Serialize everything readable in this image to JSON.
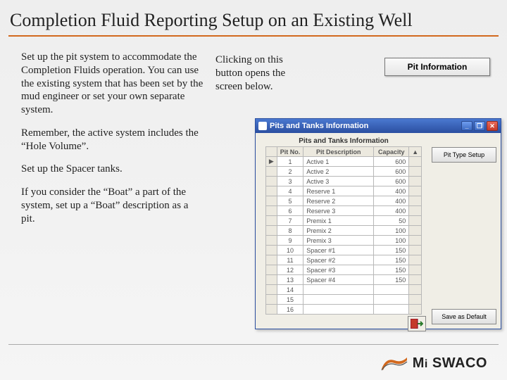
{
  "title": "Completion Fluid Reporting Setup on an Existing Well",
  "left": {
    "p1": "Set up the pit system to accommodate the Completion Fluids operation. You can use the existing system that has been set by the mud engineer or set your own separate system.",
    "p2": "Remember, the active system includes the “Hole Volume”.",
    "p3": "Set up the Spacer tanks.",
    "p4": "If you consider the “Boat” a part of the system, set up a “Boat” description as a pit."
  },
  "mid": {
    "text": "Clicking on this button opens the screen below."
  },
  "pit_info_button": "Pit Information",
  "window": {
    "title": "Pits and Tanks Information",
    "grid_title": "Pits and Tanks Information",
    "columns": {
      "pitno": "Pit No.",
      "desc": "Pit Description",
      "cap": "Capacity"
    },
    "rows": [
      {
        "no": "1",
        "desc": "Active 1",
        "cap": "600"
      },
      {
        "no": "2",
        "desc": "Active 2",
        "cap": "600"
      },
      {
        "no": "3",
        "desc": "Active 3",
        "cap": "600"
      },
      {
        "no": "4",
        "desc": "Reserve 1",
        "cap": "400"
      },
      {
        "no": "5",
        "desc": "Reserve 2",
        "cap": "400"
      },
      {
        "no": "6",
        "desc": "Reserve 3",
        "cap": "400"
      },
      {
        "no": "7",
        "desc": "Premix 1",
        "cap": "50"
      },
      {
        "no": "8",
        "desc": "Premix 2",
        "cap": "100"
      },
      {
        "no": "9",
        "desc": "Premix 3",
        "cap": "100"
      },
      {
        "no": "10",
        "desc": "Spacer #1",
        "cap": "150"
      },
      {
        "no": "11",
        "desc": "Spacer #2",
        "cap": "150"
      },
      {
        "no": "12",
        "desc": "Spacer #3",
        "cap": "150"
      },
      {
        "no": "13",
        "desc": "Spacer #4",
        "cap": "150"
      },
      {
        "no": "14",
        "desc": "",
        "cap": ""
      },
      {
        "no": "15",
        "desc": "",
        "cap": ""
      },
      {
        "no": "16",
        "desc": "",
        "cap": ""
      }
    ],
    "side_buttons": {
      "pit_type": "Pit Type Setup",
      "save_default": "Save as Default"
    },
    "win_controls": {
      "min": "_",
      "max": "❐",
      "close": "✕"
    }
  },
  "logo": {
    "brand_html": "M<span class=\"i-lower\">i</span> SWACO"
  },
  "colors": {
    "accent": "#d2691e",
    "titlebar": "#2b4fa0"
  }
}
